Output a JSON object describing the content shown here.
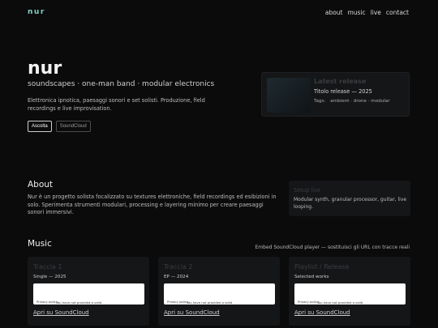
{
  "header": {
    "brand": "nur",
    "nav": [
      "about",
      "music",
      "live",
      "contact"
    ]
  },
  "hero": {
    "title": "nur",
    "subtitle": "soundscapes · one-man band · modular electronics",
    "description": "Elettronica ipnotica, paesaggi sonori e set solisti. Produzione, field recordings e live improvisation.",
    "buttons": [
      "Ascolta",
      "SoundCloud"
    ]
  },
  "latest_release": {
    "label": "Latest release",
    "title": "Titolo release — 2025",
    "tags_label": "Tags:",
    "tags": "ambient · drone · modular"
  },
  "about": {
    "heading": "About",
    "text": "Nur è un progetto solista focalizzato su textures elettroniche, field recordings ed esibizioni in solo. Sperimenta strumenti modulari, processing e layering minimo per creare paesaggi sonori immersivi.",
    "setup_title": "Setup live",
    "setup_text": "Modular synth, granular processor, guitar, live looping."
  },
  "music": {
    "heading": "Music",
    "embed_note": "Embed SoundCloud player — sostituisci gli URL con tracce reali",
    "cards": [
      {
        "title": "Traccia 1",
        "subtitle": "Single — 2025",
        "policy": "Privacy policy",
        "embed_msg": "You have not provided a valid",
        "link": "Apri su SoundCloud"
      },
      {
        "title": "Traccia 2",
        "subtitle": "EP — 2024",
        "policy": "Privacy policy",
        "embed_msg": "You have not provided a valid",
        "link": "Apri su SoundCloud"
      },
      {
        "title": "Playlist / Release",
        "subtitle": "Selected works",
        "policy": "Privacy policy",
        "embed_msg": "You have not provided a valid",
        "link": "Apri su SoundCloud"
      }
    ]
  },
  "colors": {
    "background": "#0b0b0c",
    "accent": "#7fd3c9",
    "card": "#151618"
  }
}
